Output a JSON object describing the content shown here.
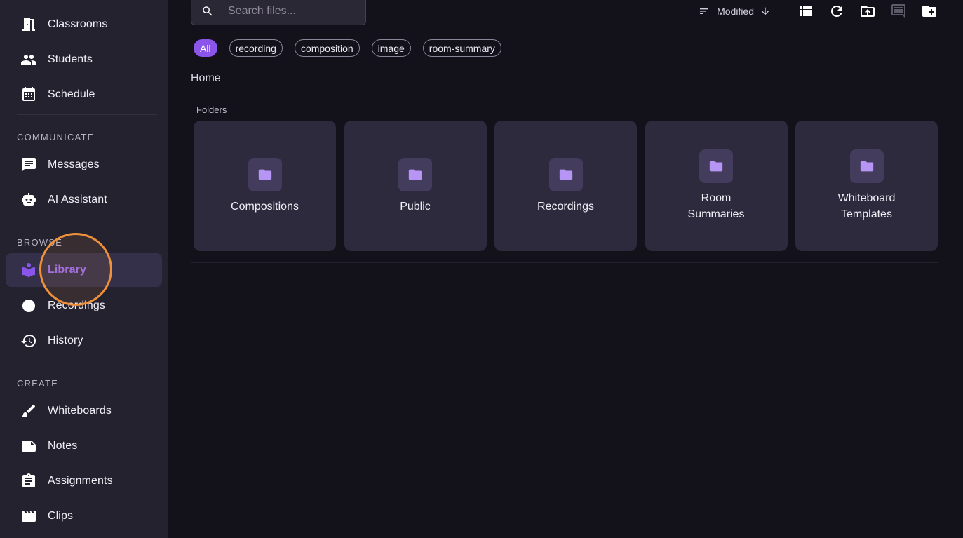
{
  "sidebar": {
    "items_top": [
      {
        "label": "Classrooms",
        "icon": "door-icon"
      },
      {
        "label": "Students",
        "icon": "people-icon"
      },
      {
        "label": "Schedule",
        "icon": "calendar-icon"
      }
    ],
    "communicate_title": "COMMUNICATE",
    "items_communicate": [
      {
        "label": "Messages",
        "icon": "message-icon"
      },
      {
        "label": "AI Assistant",
        "icon": "robot-icon"
      }
    ],
    "browse_title": "BROWSE",
    "items_browse": [
      {
        "label": "Library",
        "icon": "library-icon",
        "active": true
      },
      {
        "label": "Recordings",
        "icon": "record-dot-icon"
      },
      {
        "label": "History",
        "icon": "history-icon"
      }
    ],
    "create_title": "CREATE",
    "items_create": [
      {
        "label": "Whiteboards",
        "icon": "brush-icon"
      },
      {
        "label": "Notes",
        "icon": "note-icon"
      },
      {
        "label": "Assignments",
        "icon": "clipboard-icon"
      },
      {
        "label": "Clips",
        "icon": "clapperboard-icon"
      }
    ]
  },
  "search": {
    "placeholder": "Search files..."
  },
  "toolbar": {
    "sort_label": "Modified"
  },
  "filters": [
    "All",
    "recording",
    "composition",
    "image",
    "room-summary"
  ],
  "breadcrumb": "Home",
  "folders_title": "Folders",
  "folders": [
    "Compositions",
    "Public",
    "Recordings",
    "Room Summaries",
    "Whiteboard Templates"
  ],
  "colors": {
    "accent": "#8b55ea",
    "sidebar_bg": "#24222f",
    "card_bg": "#2e2a3e",
    "focus_ring": "#f0913a"
  }
}
